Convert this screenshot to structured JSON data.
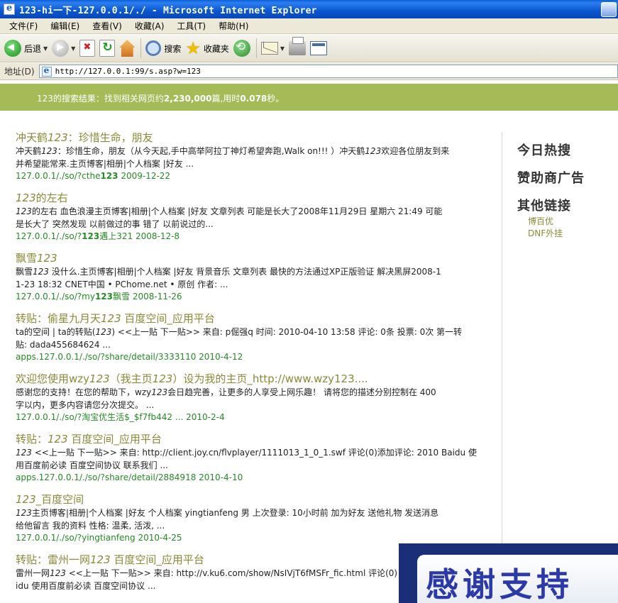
{
  "window": {
    "title": "123-hi一下-127.0.0.1/./ - Microsoft Internet Explorer"
  },
  "menu": [
    "文件(F)",
    "编辑(E)",
    "查看(V)",
    "收藏(A)",
    "工具(T)",
    "帮助(H)"
  ],
  "toolbar": {
    "back_label": "后退",
    "search_label": "搜索",
    "favorites_label": "收藏夹"
  },
  "address": {
    "label": "地址(D)",
    "url": "http://127.0.0.1:99/s.asp?w=123"
  },
  "summary": {
    "prefix": "123的搜索结果：找到相关网页约",
    "count": "2,230,000",
    "middle": "篇,用时",
    "time": "0.078",
    "suffix": "秒。"
  },
  "results": [
    {
      "title": [
        "冲天鹤",
        "123",
        "：珍惜生命，朋友"
      ],
      "snippet": [
        [
          "冲天鹤",
          "123",
          "：珍惜生命，朋友（从今天起,手中高举阿拉丁神灯希望奔跑,Walk on!!! ）冲天鹤",
          "123",
          "欢迎各位朋友到来"
        ],
        [
          "并希望能常来.主页博客|相册|个人档案 |好友 ..."
        ]
      ],
      "url": [
        "127.0.0.1/./so/?cthe",
        "123",
        " 2009-12-22"
      ]
    },
    {
      "title": [
        "",
        "123",
        "的左右"
      ],
      "snippet": [
        [
          "",
          "123",
          "的左右 血色浪漫主页博客|相册|个人档案 |好友 文章列表 可能是长大了2008年11月29日 星期六 21:49 可能"
        ],
        [
          "是长大了 突然发现 以前做过的事 错了 以前说过的..."
        ]
      ],
      "url": [
        "127.0.0.1/./so/?",
        "123",
        "遇上321 2008-12-8"
      ]
    },
    {
      "title": [
        "飘雪",
        "123",
        ""
      ],
      "snippet": [
        [
          "飘雪",
          "123",
          " 没什么.主页博客|相册|个人档案 |好友 背景音乐 文章列表 最快的方法通过XP正版验证 解决黑屏2008-1"
        ],
        [
          "1-23 18:32 CNET中国 • PChome.net • 原创 作者: ..."
        ]
      ],
      "url": [
        "127.0.0.1/./so/?my",
        "123",
        "飘雪 2008-11-26"
      ]
    },
    {
      "title": [
        "转贴：偷星九月天",
        "123",
        " 百度空间_应用平台"
      ],
      "snippet": [
        [
          "ta的空间 | ta的转贴(",
          "123",
          ") <<上一贴 下一贴>> 来自: p倔强q 时间: 2010-04-10 13:58 评论: 0条 投票: 0次 第一转"
        ],
        [
          "贴: dada455684624 ..."
        ]
      ],
      "url": [
        "apps.127.0.0.1/./so/?share/detail/3333110 2010-4-12",
        "",
        ""
      ]
    },
    {
      "title": [
        "欢迎您使用wzy",
        "123",
        "（我主页",
        "123",
        "）设为我的主页_http://www.wzy123...."
      ],
      "snippet": [
        [
          "感谢您的支持！在您的帮助下，wzy",
          "123",
          "会日趋完善，让更多的人享受上网乐趣！ 请将您的描述分别控制在 400"
        ],
        [
          "字以内，更多内容请您分次提交。 ..."
        ]
      ],
      "url": [
        "127.0.0.1/./so/?淘宝优生活$_$f7fb442 ... 2010-2-4",
        "",
        ""
      ]
    },
    {
      "title": [
        "转贴：",
        "123",
        " 百度空间_应用平台"
      ],
      "snippet": [
        [
          "",
          "123",
          " <<上一贴 下一贴>> 来自: http://client.joy.cn/flvplayer/1111013_1_0_1.swf 评论(0)添加评论: 2010 Baidu 使"
        ],
        [
          "用百度前必读 百度空间协议 联系我们 ..."
        ]
      ],
      "url": [
        "apps.127.0.0.1/./so/?share/detail/2884918 2010-4-10",
        "",
        ""
      ]
    },
    {
      "title": [
        "",
        "123",
        "_百度空间"
      ],
      "snippet": [
        [
          "",
          "123",
          "主页博客|相册|个人档案 |好友 个人档案 yingtianfeng 男 上次登录: 10小时前 加为好友 送他礼物 发送消息"
        ],
        [
          "给他留言 我的资料 性格: 温柔, 活泼, ..."
        ]
      ],
      "url": [
        "127.0.0.1/./so/?yingtianfeng 2010-4-25",
        "",
        ""
      ]
    },
    {
      "title": [
        "转贴：雷州一网",
        "123",
        " 百度空间_应用平台"
      ],
      "snippet": [
        [
          "雷州一网",
          "123",
          " <<上一贴 下一贴>> 来自: http://v.ku6.com/show/NsIVjT6fMSFr_fic.html 评论(0)"
        ],
        [
          "idu 使用百度前必读 百度空间协议 ..."
        ]
      ],
      "url": [
        "",
        "",
        ""
      ]
    }
  ],
  "sidebar": {
    "hot_today": "今日热搜",
    "sponsor_ads": "赞助商广告",
    "other_links": "其他链接",
    "links": [
      "博百优",
      "DNF外挂"
    ]
  },
  "thanks_banner": "感谢支持"
}
